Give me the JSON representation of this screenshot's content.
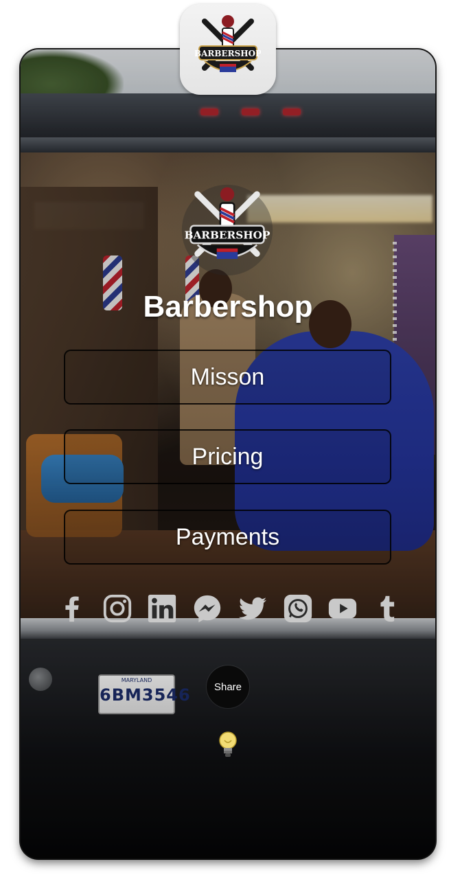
{
  "app": {
    "title": "Barbershop",
    "logo": {
      "icon": "barbershop-logo-icon",
      "text": "BARBERSHOP"
    }
  },
  "menu": [
    {
      "label": "Misson"
    },
    {
      "label": "Pricing"
    },
    {
      "label": "Payments"
    }
  ],
  "social": [
    {
      "icon": "facebook-icon"
    },
    {
      "icon": "instagram-icon"
    },
    {
      "icon": "linkedin-icon"
    },
    {
      "icon": "messenger-icon"
    },
    {
      "icon": "twitter-icon"
    },
    {
      "icon": "whatsapp-icon"
    },
    {
      "icon": "youtube-icon"
    },
    {
      "icon": "tumblr-icon"
    }
  ],
  "share": {
    "label": "Share"
  },
  "footer": {
    "icon": "lightbulb-icon"
  },
  "background": {
    "plate_state": "MARYLAND",
    "plate_number": "6BM3546"
  },
  "colors": {
    "text": "#ffffff",
    "social_icon": "#c9c9c9",
    "button_border": "#000000"
  }
}
